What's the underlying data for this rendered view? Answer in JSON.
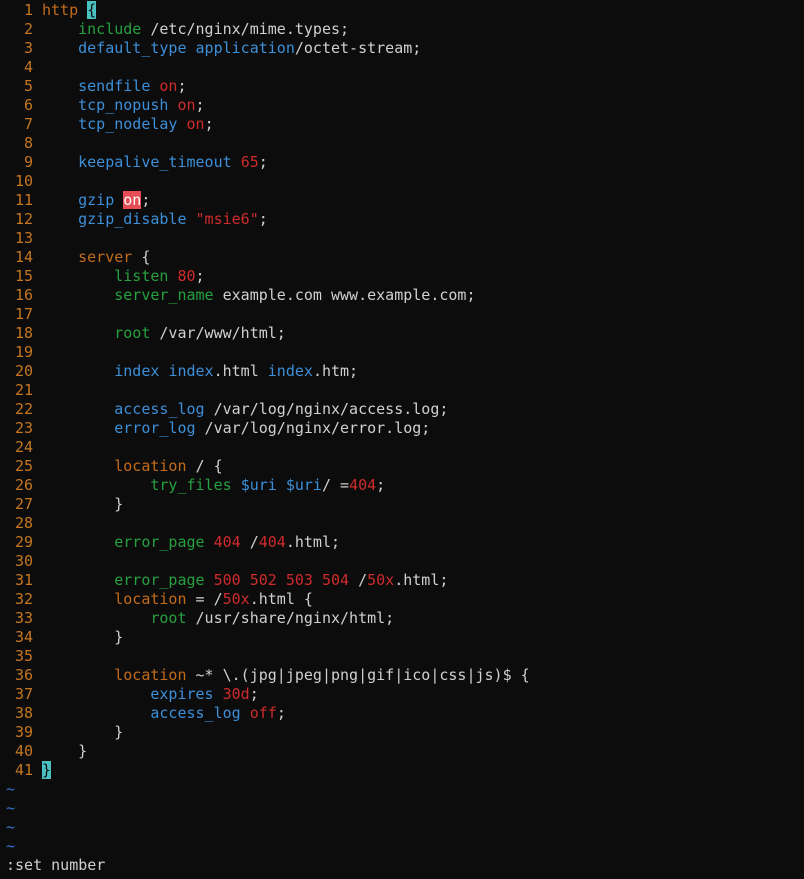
{
  "editor": {
    "lines": [
      {
        "n": "1",
        "tokens": [
          [
            "kw",
            "http"
          ],
          [
            "txt",
            " "
          ],
          [
            "bracket",
            "{"
          ]
        ]
      },
      {
        "n": "2",
        "tokens": [
          [
            "txt",
            "    "
          ],
          [
            "dir2",
            "include"
          ],
          [
            "txt",
            " /etc/nginx/mime.types;"
          ]
        ]
      },
      {
        "n": "3",
        "tokens": [
          [
            "txt",
            "    "
          ],
          [
            "dir",
            "default_type"
          ],
          [
            "txt",
            " "
          ],
          [
            "dir",
            "application"
          ],
          [
            "txt",
            "/octet-stream;"
          ]
        ]
      },
      {
        "n": "4",
        "tokens": []
      },
      {
        "n": "5",
        "tokens": [
          [
            "txt",
            "    "
          ],
          [
            "dir",
            "sendfile"
          ],
          [
            "txt",
            " "
          ],
          [
            "val",
            "on"
          ],
          [
            "txt",
            ";"
          ]
        ]
      },
      {
        "n": "6",
        "tokens": [
          [
            "txt",
            "    "
          ],
          [
            "dir",
            "tcp_nopush"
          ],
          [
            "txt",
            " "
          ],
          [
            "val",
            "on"
          ],
          [
            "txt",
            ";"
          ]
        ]
      },
      {
        "n": "7",
        "tokens": [
          [
            "txt",
            "    "
          ],
          [
            "dir",
            "tcp_nodelay"
          ],
          [
            "txt",
            " "
          ],
          [
            "val",
            "on"
          ],
          [
            "txt",
            ";"
          ]
        ]
      },
      {
        "n": "8",
        "tokens": []
      },
      {
        "n": "9",
        "tokens": [
          [
            "txt",
            "    "
          ],
          [
            "dir",
            "keepalive_timeout"
          ],
          [
            "txt",
            " "
          ],
          [
            "val",
            "65"
          ],
          [
            "txt",
            ";"
          ]
        ]
      },
      {
        "n": "10",
        "tokens": []
      },
      {
        "n": "11",
        "tokens": [
          [
            "txt",
            "    "
          ],
          [
            "dir",
            "gzip"
          ],
          [
            "txt",
            " "
          ],
          [
            "hl",
            "on"
          ],
          [
            "txt",
            ";"
          ]
        ]
      },
      {
        "n": "12",
        "tokens": [
          [
            "txt",
            "    "
          ],
          [
            "dir",
            "gzip_disable"
          ],
          [
            "txt",
            " "
          ],
          [
            "str",
            "\"msie6\""
          ],
          [
            "txt",
            ";"
          ]
        ]
      },
      {
        "n": "13",
        "tokens": []
      },
      {
        "n": "14",
        "tokens": [
          [
            "txt",
            "    "
          ],
          [
            "kw",
            "server"
          ],
          [
            "txt",
            " {"
          ]
        ]
      },
      {
        "n": "15",
        "tokens": [
          [
            "txt",
            "        "
          ],
          [
            "dir2",
            "listen"
          ],
          [
            "txt",
            " "
          ],
          [
            "val",
            "80"
          ],
          [
            "txt",
            ";"
          ]
        ]
      },
      {
        "n": "16",
        "tokens": [
          [
            "txt",
            "        "
          ],
          [
            "dir2",
            "server_name"
          ],
          [
            "txt",
            " example.com www.example.com;"
          ]
        ]
      },
      {
        "n": "17",
        "tokens": []
      },
      {
        "n": "18",
        "tokens": [
          [
            "txt",
            "        "
          ],
          [
            "dir2",
            "root"
          ],
          [
            "txt",
            " /var/www/html;"
          ]
        ]
      },
      {
        "n": "19",
        "tokens": []
      },
      {
        "n": "20",
        "tokens": [
          [
            "txt",
            "        "
          ],
          [
            "dir",
            "index"
          ],
          [
            "txt",
            " "
          ],
          [
            "dir",
            "index"
          ],
          [
            "txt",
            ".html "
          ],
          [
            "dir",
            "index"
          ],
          [
            "txt",
            ".htm;"
          ]
        ]
      },
      {
        "n": "21",
        "tokens": []
      },
      {
        "n": "22",
        "tokens": [
          [
            "txt",
            "        "
          ],
          [
            "dir",
            "access_log"
          ],
          [
            "txt",
            " /var/log/nginx/access.log;"
          ]
        ]
      },
      {
        "n": "23",
        "tokens": [
          [
            "txt",
            "        "
          ],
          [
            "dir",
            "error_log"
          ],
          [
            "txt",
            " /var/log/nginx/error.log;"
          ]
        ]
      },
      {
        "n": "24",
        "tokens": []
      },
      {
        "n": "25",
        "tokens": [
          [
            "txt",
            "        "
          ],
          [
            "kw",
            "location"
          ],
          [
            "txt",
            " / {"
          ]
        ]
      },
      {
        "n": "26",
        "tokens": [
          [
            "txt",
            "            "
          ],
          [
            "dir2",
            "try_files"
          ],
          [
            "txt",
            " "
          ],
          [
            "dir",
            "$uri"
          ],
          [
            "txt",
            " "
          ],
          [
            "dir",
            "$uri"
          ],
          [
            "txt",
            "/ ="
          ],
          [
            "val",
            "404"
          ],
          [
            "txt",
            ";"
          ]
        ]
      },
      {
        "n": "27",
        "tokens": [
          [
            "txt",
            "        }"
          ]
        ]
      },
      {
        "n": "28",
        "tokens": []
      },
      {
        "n": "29",
        "tokens": [
          [
            "txt",
            "        "
          ],
          [
            "dir2",
            "error_page"
          ],
          [
            "txt",
            " "
          ],
          [
            "val",
            "404"
          ],
          [
            "txt",
            " /"
          ],
          [
            "val",
            "404"
          ],
          [
            "txt",
            ".html;"
          ]
        ]
      },
      {
        "n": "30",
        "tokens": []
      },
      {
        "n": "31",
        "tokens": [
          [
            "txt",
            "        "
          ],
          [
            "dir2",
            "error_page"
          ],
          [
            "txt",
            " "
          ],
          [
            "val",
            "500 502 503 504"
          ],
          [
            "txt",
            " /"
          ],
          [
            "val",
            "50x"
          ],
          [
            "txt",
            ".html;"
          ]
        ]
      },
      {
        "n": "32",
        "tokens": [
          [
            "txt",
            "        "
          ],
          [
            "kw",
            "location"
          ],
          [
            "txt",
            " = /"
          ],
          [
            "val",
            "50x"
          ],
          [
            "txt",
            ".html {"
          ]
        ]
      },
      {
        "n": "33",
        "tokens": [
          [
            "txt",
            "            "
          ],
          [
            "dir2",
            "root"
          ],
          [
            "txt",
            " /usr/share/nginx/html;"
          ]
        ]
      },
      {
        "n": "34",
        "tokens": [
          [
            "txt",
            "        }"
          ]
        ]
      },
      {
        "n": "35",
        "tokens": []
      },
      {
        "n": "36",
        "tokens": [
          [
            "txt",
            "        "
          ],
          [
            "kw",
            "location"
          ],
          [
            "txt",
            " ~* \\.(jpg|jpeg|png|gif|ico|css|js)$ {"
          ]
        ]
      },
      {
        "n": "37",
        "tokens": [
          [
            "txt",
            "            "
          ],
          [
            "dir",
            "expires"
          ],
          [
            "txt",
            " "
          ],
          [
            "val",
            "30d"
          ],
          [
            "txt",
            ";"
          ]
        ]
      },
      {
        "n": "38",
        "tokens": [
          [
            "txt",
            "            "
          ],
          [
            "dir",
            "access_log"
          ],
          [
            "txt",
            " "
          ],
          [
            "val",
            "off"
          ],
          [
            "txt",
            ";"
          ]
        ]
      },
      {
        "n": "39",
        "tokens": [
          [
            "txt",
            "        }"
          ]
        ]
      },
      {
        "n": "40",
        "tokens": [
          [
            "txt",
            "    }"
          ]
        ]
      },
      {
        "n": "41",
        "tokens": [
          [
            "bracket",
            "}"
          ]
        ]
      }
    ],
    "tildes": [
      "~",
      "~",
      "~",
      "~"
    ]
  },
  "cmdline": {
    "text": ":set number"
  }
}
